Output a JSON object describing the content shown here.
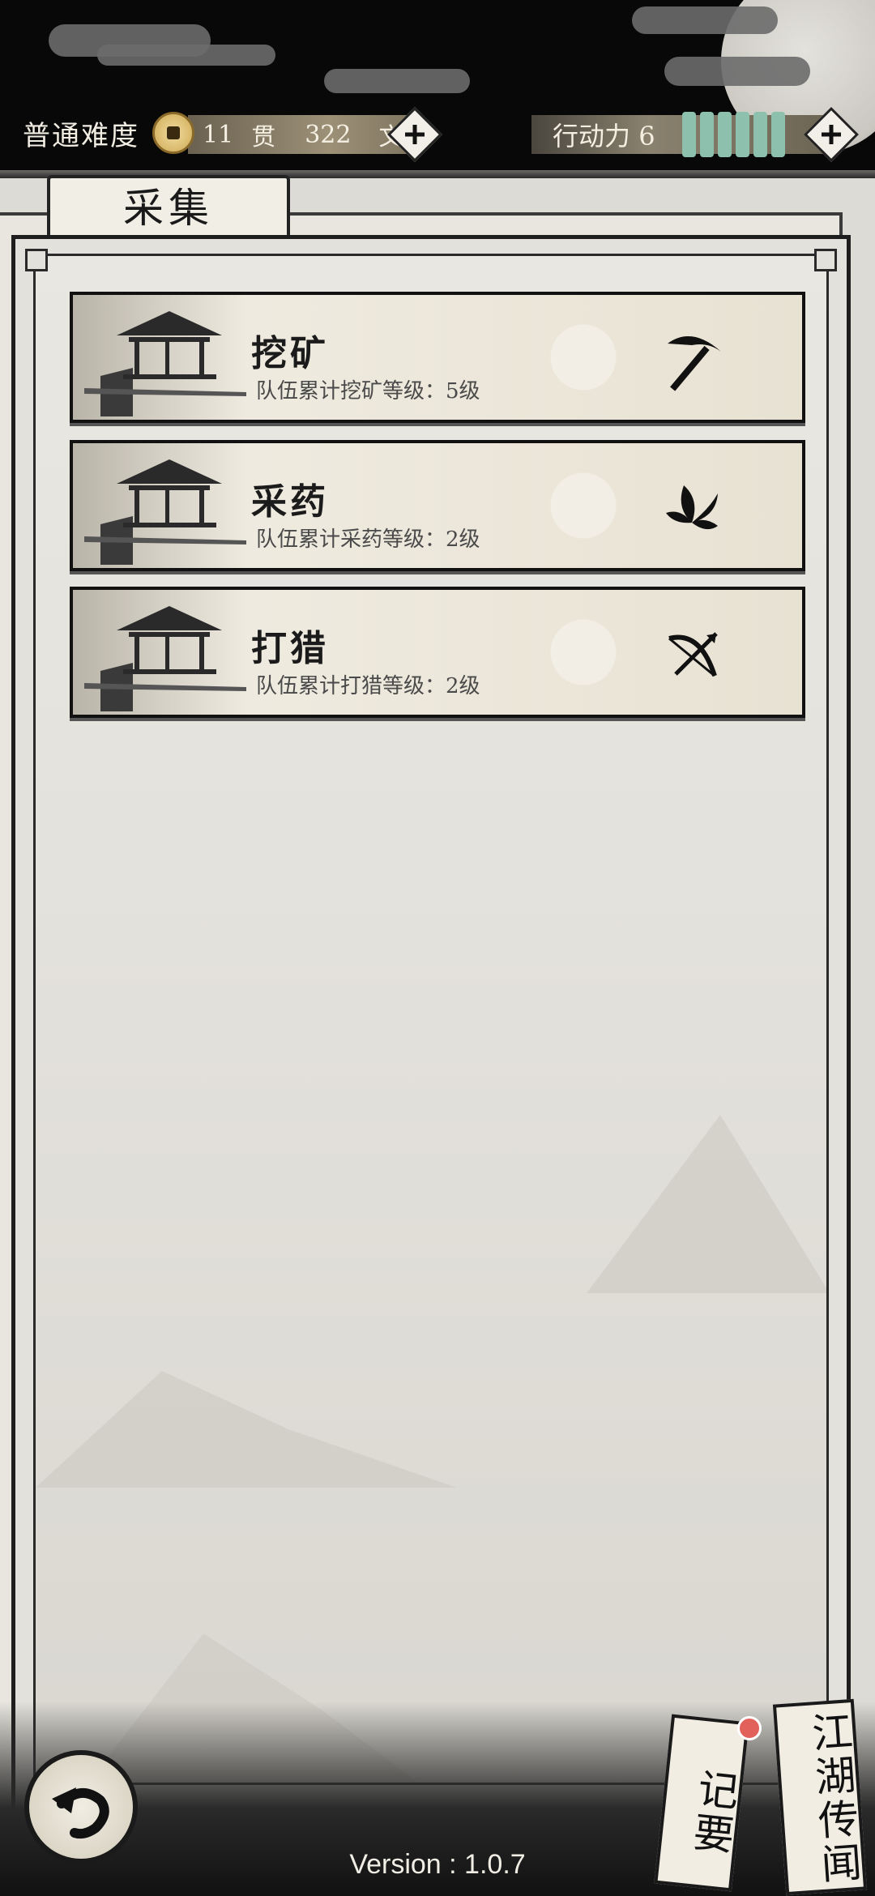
{
  "header": {
    "difficulty": "普通难度",
    "money_guan": "11",
    "money_guan_unit": "贯",
    "money_wen": "322",
    "money_wen_unit": "文",
    "stamina_label": "行动力",
    "stamina_value": "6",
    "stamina_pips": 6
  },
  "tab": {
    "label": "采集"
  },
  "cards": [
    {
      "title": "挖矿",
      "level_text": "队伍累计挖矿等级：5级",
      "icon": "pickaxe-icon"
    },
    {
      "title": "采药",
      "level_text": "队伍累计采药等级：2级",
      "icon": "herb-leaf-icon"
    },
    {
      "title": "打猎",
      "level_text": "队伍累计打猎等级：2级",
      "icon": "crossbow-icon"
    }
  ],
  "footer": {
    "version": "Version : 1.0.7",
    "notes_label": "记要",
    "rumors_label": "江湖传闻"
  },
  "colors": {
    "stamina_pip": "#8ec1ad",
    "notification_dot": "#e2615a",
    "coin": "#d9b96a"
  }
}
